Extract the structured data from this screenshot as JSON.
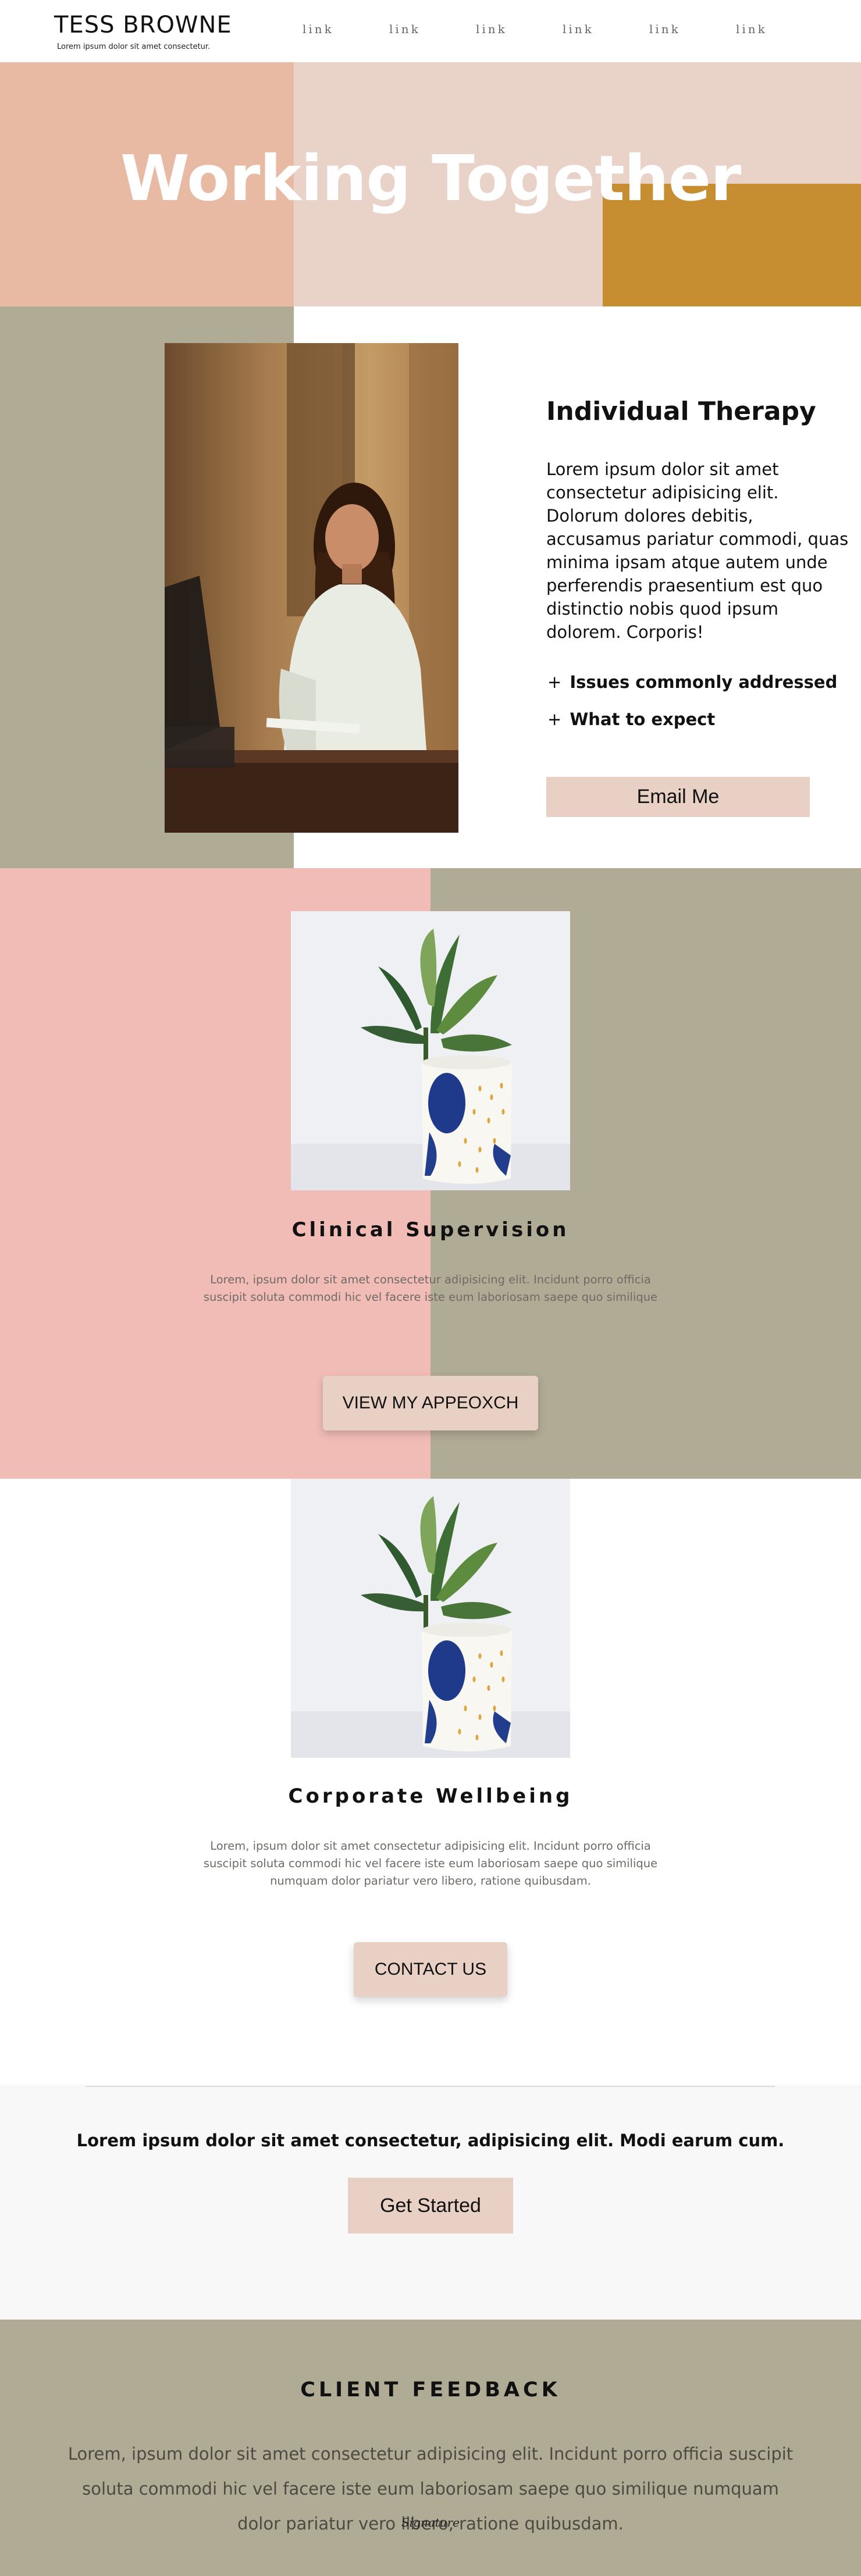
{
  "brand": {
    "name": "TESS BROWNE",
    "tagline": "Lorem ipsum dolor sit amet consectetur."
  },
  "nav": {
    "links": [
      "link",
      "link",
      "link",
      "link",
      "link",
      "link"
    ]
  },
  "hero": {
    "title": "Working Together"
  },
  "therapy": {
    "title": "Individual Therapy",
    "text": "Lorem ipsum dolor sit amet consectetur adipisicing elit. Dolorum dolores debitis, accusamus pariatur commodi, quas minima ipsam atque autem unde perferendis praesentium est quo distinctio nobis quod ipsum dolorem. Corporis!",
    "accordion": [
      {
        "icon": "+",
        "label": "Issues commonly addressed"
      },
      {
        "icon": "+",
        "label": "What to expect"
      }
    ],
    "button": "Email Me"
  },
  "supervision": {
    "title": "Clinical Supervision",
    "text": "Lorem, ipsum dolor sit amet consectetur adipisicing elit. Incidunt porro officia suscipit soluta commodi hic vel facere iste eum laboriosam saepe quo similique",
    "button": "VIEW MY APPEOXCH"
  },
  "wellbeing": {
    "title": "Corporate Wellbeing",
    "text": "Lorem, ipsum dolor sit amet consectetur adipisicing elit. Incidunt porro officia suscipit soluta commodi hic vel facere iste eum laboriosam saepe quo similique numquam dolor pariatur vero libero, ratione quibusdam.",
    "button": "CONTACT US"
  },
  "cta": {
    "text": "Lorem ipsum dolor sit amet consectetur, adipisicing elit. Modi earum cum.",
    "button": "Get Started"
  },
  "feedback": {
    "title": "CLIENT FEEDBACK",
    "text": "Lorem, ipsum dolor sit amet consectetur adipisicing elit. Incidunt porro officia suscipit soluta commodi hic vel facere iste eum laboriosam saepe quo similique numquam dolor pariatur vero libero, ratione quibusdam.",
    "signature": "Signature"
  },
  "colors": {
    "hero_peach": "#e8b9a3",
    "hero_blush": "#e9d2c7",
    "hero_gold": "#c68d31",
    "sage": "#b0ab94",
    "pink": "#f2bcb6",
    "button": "#e8d0c4"
  }
}
